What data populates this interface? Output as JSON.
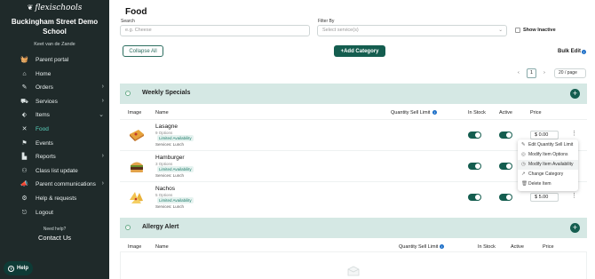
{
  "sidebar": {
    "brand": "flexischools",
    "school": "Buckingham Street Demo School",
    "user": "Keet van de Zande",
    "items": [
      {
        "label": "Parent portal",
        "icon": "basket-icon",
        "chevron": false,
        "active": false
      },
      {
        "label": "Home",
        "icon": "home-icon",
        "chevron": false,
        "active": false
      },
      {
        "label": "Orders",
        "icon": "pencil-icon",
        "chevron": true,
        "active": false
      },
      {
        "label": "Services",
        "icon": "truck-icon",
        "chevron": true,
        "active": false
      },
      {
        "label": "Items",
        "icon": "tag-icon",
        "chevron": true,
        "active": true
      },
      {
        "label": "Food",
        "icon": "cutlery-icon",
        "chevron": false,
        "active": true
      },
      {
        "label": "Events",
        "icon": "flag-icon",
        "chevron": false,
        "active": false
      },
      {
        "label": "Reports",
        "icon": "chart-icon",
        "chevron": true,
        "active": false
      },
      {
        "label": "Class list update",
        "icon": "people-icon",
        "chevron": false,
        "active": false
      },
      {
        "label": "Parent communications",
        "icon": "megaphone-icon",
        "chevron": true,
        "active": false
      },
      {
        "label": "Help & requests",
        "icon": "gear-icon",
        "chevron": false,
        "active": false
      },
      {
        "label": "Logout",
        "icon": "logout-icon",
        "chevron": false,
        "active": false
      }
    ],
    "need_help": "Need help?",
    "contact": "Contact Us",
    "help_button": "Help"
  },
  "main": {
    "title": "Food",
    "search_label": "Search",
    "search_placeholder": "e.g. Cheese",
    "filter_label": "Filter By",
    "filter_placeholder": "Select service(s)",
    "show_inactive": "Show Inactive",
    "collapse_all": "Collapse All",
    "add_category": "+Add Category",
    "bulk_edit": "Bulk Edit",
    "pager": {
      "prev": "‹",
      "page": "1",
      "next": "›",
      "page_size": "20 / page"
    },
    "sections": [
      {
        "title": "Weekly Specials",
        "headers": {
          "image": "Image",
          "name": "Name",
          "qsl": "Quantity Sell Limit",
          "stock": "In Stock",
          "active": "Active",
          "price": "Price"
        },
        "rows": [
          {
            "name": "Lasagne",
            "options": "9 Options",
            "badge": "Limited Availability",
            "services": "Services: Lunch",
            "price": "$ 0.00",
            "in_stock": true,
            "active": true
          },
          {
            "name": "Hamburger",
            "options": "3 Options",
            "badge": "Limited Availability",
            "services": "Services: Lunch",
            "price": "$ 0.00",
            "in_stock": true,
            "active": true
          },
          {
            "name": "Nachos",
            "options": "5 Options",
            "badge": "Limited Availability",
            "services": "Services: Lunch",
            "price": "$ 5.00",
            "in_stock": true,
            "active": true
          }
        ]
      },
      {
        "title": "Allergy Alert",
        "headers": {
          "image": "Image",
          "name": "Name",
          "qsl": "Quantity Sell Limit",
          "stock": "In Stock",
          "active": "Active",
          "price": "Price"
        }
      }
    ],
    "context_menu": [
      {
        "label": "Edit Quantity Sell Limit",
        "icon": "pencil-icon"
      },
      {
        "label": "Modify Item Options",
        "icon": "options-icon"
      },
      {
        "label": "Modify Item Availability",
        "icon": "clock-icon"
      },
      {
        "label": "Change Category",
        "icon": "link-icon"
      },
      {
        "label": "Delete Item",
        "icon": "trash-icon"
      }
    ]
  },
  "colors": {
    "sidebar": "#1f2a2a",
    "accent": "#145d4f",
    "active_nav": "#5ad3bf",
    "section_bg": "#d5e8e4"
  }
}
